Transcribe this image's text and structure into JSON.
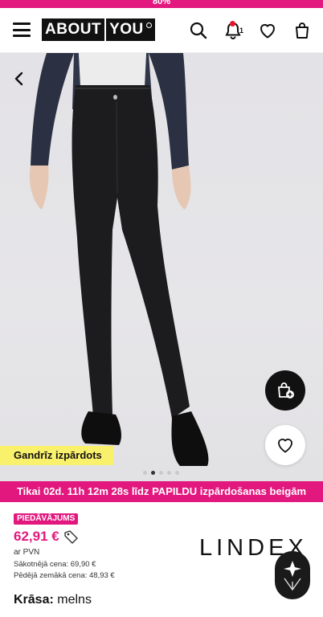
{
  "top_strip": {
    "text": "80%"
  },
  "header": {
    "logo_left": "ABOUT",
    "logo_right": "YOU",
    "notification_count": "1"
  },
  "gallery": {
    "badge": "Gandrīz izpārdots",
    "total_images": 5,
    "active_index": 1
  },
  "promo_banner": {
    "text": "Tikai 02d. 11h 12m 28s līdz PAPILDU izpārdošanas beigām"
  },
  "product": {
    "offer_label": "PIEDĀVĀJUMS",
    "price": "62,91 €",
    "vat": "ar PVN",
    "original_price": "Sākotnējā cena: 69,90 €",
    "lowest_price": "Pēdējā zemākā cena: 48,93 €",
    "color_label": "Krāsa:",
    "color_value": "melns",
    "brand": "LINDEX"
  },
  "colors": {
    "accent": "#e2187e",
    "highlight": "#f9f06c",
    "dark": "#111111"
  }
}
